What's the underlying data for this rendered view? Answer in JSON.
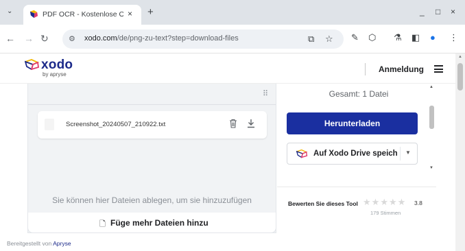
{
  "browser": {
    "tab_title": "PDF OCR - Kostenlose OCR",
    "tab_menu_icon": "chevron-down-icon",
    "new_tab_label": "+",
    "close_label": "×",
    "url_host": "xodo.com",
    "url_path": "/de/png-zu-text?step=download-files",
    "window_controls": [
      "_",
      "□",
      "×"
    ]
  },
  "header": {
    "logo_text": "xodo",
    "logo_sub": "by apryse",
    "login_label": "Anmeldung"
  },
  "main": {
    "file_name": "Screenshot_20240507_210922.txt",
    "drop_hint": "Sie können hier Dateien ablegen, um sie hinzuzufügen",
    "add_more_label": "Füge mehr Dateien hinzu",
    "powered_prefix": "Bereitgestellt von",
    "powered_link": "Apryse"
  },
  "sidebar": {
    "total": "Gesamt: 1 Datei",
    "download_label": "Herunterladen",
    "drive_label": "Auf Xodo Drive speichern",
    "rate_label": "Bewerten Sie dieses Tool",
    "score": "3.8",
    "votes": "179 Stimmen",
    "rating_value": 3.8,
    "rating_max": 5
  },
  "colors": {
    "brand_blue": "#1a2fa0",
    "logo_blue": "#1c2a8a",
    "logo_yellow": "#f2b705"
  }
}
